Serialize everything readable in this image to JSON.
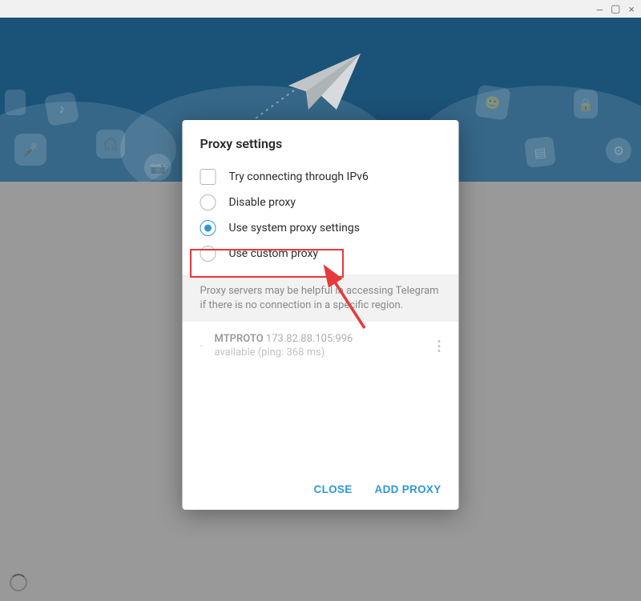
{
  "window_controls": {
    "minimize": "–",
    "maximize": "▢",
    "close": "×"
  },
  "modal": {
    "title": "Proxy settings",
    "options": {
      "ipv6": "Try connecting through IPv6",
      "disable": "Disable proxy",
      "system": "Use system proxy settings",
      "custom": "Use custom proxy"
    },
    "info_text": "Proxy servers may be helpful in accessing Telegram if there is no connection in a specific region.",
    "proxy_item": {
      "protocol": "MTPROTO",
      "address": "173.82.88.105:996",
      "status": "available (ping: 368 ms)"
    },
    "buttons": {
      "close": "CLOSE",
      "add": "ADD PROXY"
    }
  }
}
